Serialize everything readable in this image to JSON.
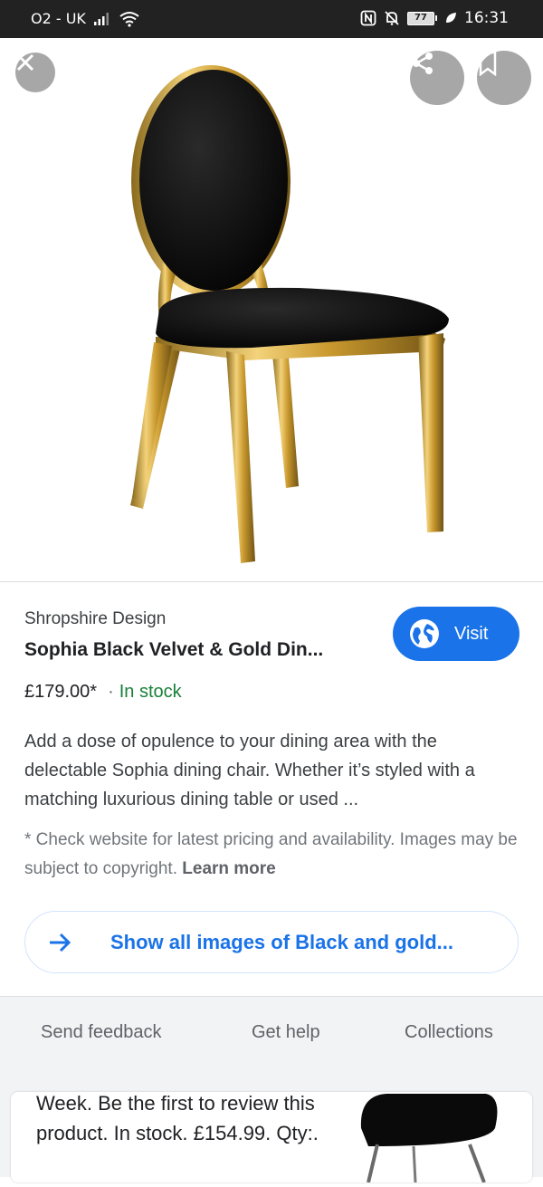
{
  "status_bar": {
    "carrier": "O2 - UK",
    "battery": "77",
    "time": "16:31"
  },
  "product": {
    "merchant": "Shropshire Design",
    "title": "Sophia Black Velvet & Gold Din...",
    "price": "£179.00*",
    "separator": "·",
    "stock": "In stock",
    "description": "Add a dose of opulence to your dining area with the delectable Sophia dining chair. Whether it’s styled with a matching luxurious dining table or used ...",
    "disclaimer": "* Check website for latest pricing and availability. Images may be subject to copyright.",
    "learn_more": "Learn more",
    "visit_label": "Visit"
  },
  "show_all": {
    "label": "Show all images of Black and gold..."
  },
  "footer": {
    "send_feedback": "Send feedback",
    "get_help": "Get help",
    "collections": "Collections"
  },
  "result_card": {
    "text": "Week. Be the first to review this product. In stock. £154.99. Qty:."
  },
  "colors": {
    "accent": "#1a73e8",
    "in_stock": "#188038",
    "status_bar": "#222222",
    "footer_bg": "#f1f3f4"
  },
  "icons": {
    "signal": "signal-icon",
    "wifi": "wifi-icon",
    "nfc": "nfc-icon",
    "mute": "bell-off-icon",
    "eco": "leaf-icon",
    "close": "close-icon",
    "share": "share-icon",
    "bookmark": "bookmark-icon",
    "globe": "globe-icon",
    "arrow": "arrow-right-icon"
  }
}
